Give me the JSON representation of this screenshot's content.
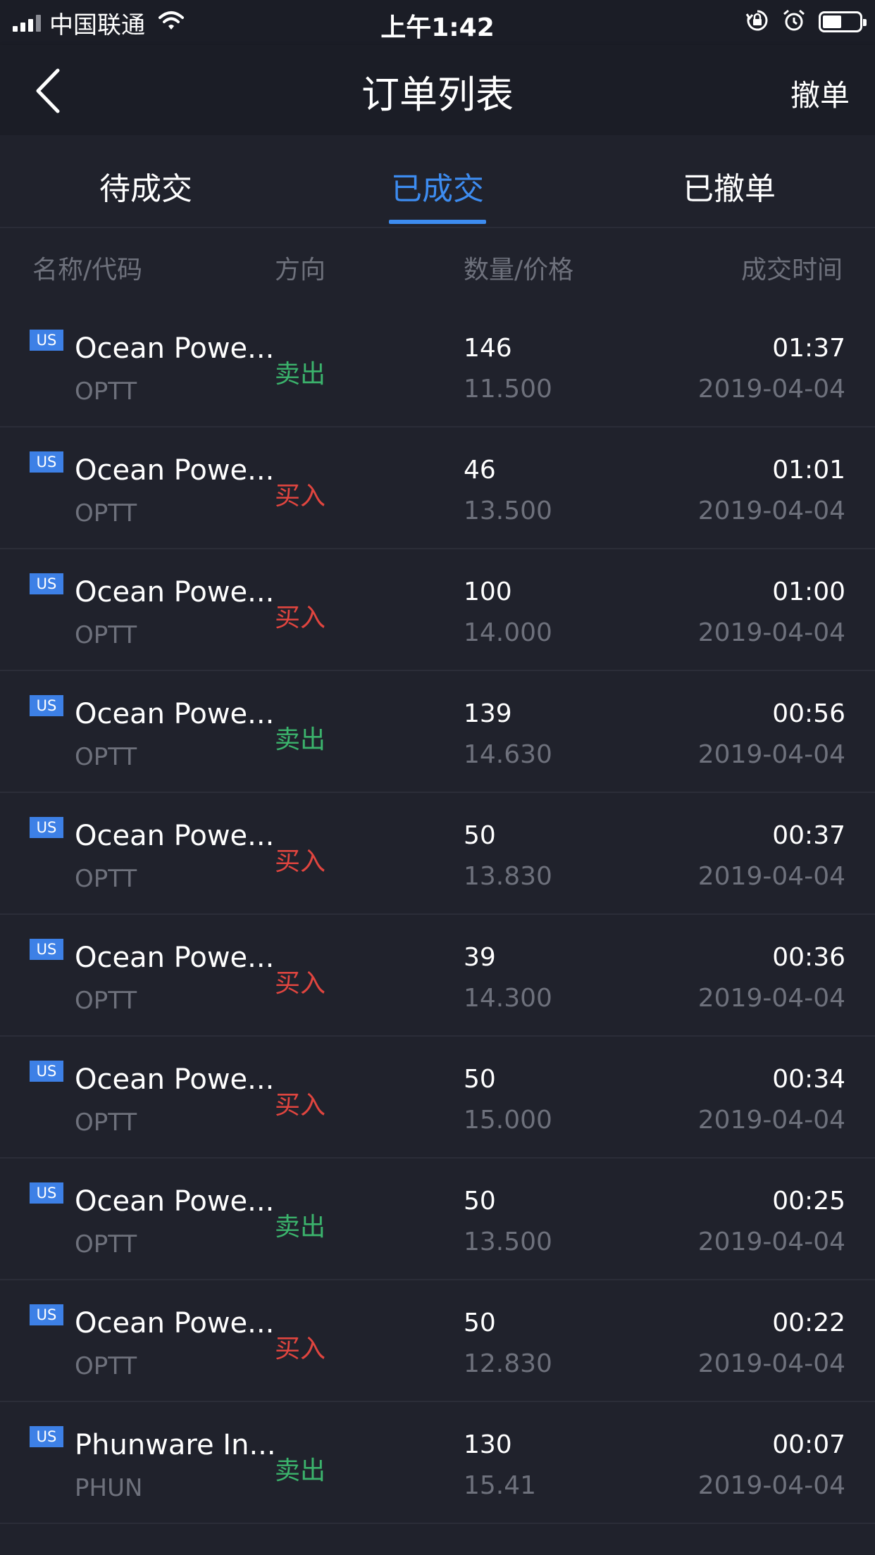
{
  "status_bar": {
    "carrier": "中国联通",
    "time": "上午1:42",
    "icons": [
      "signal-icon",
      "wifi-icon",
      "rotation-lock-icon",
      "alarm-icon",
      "battery-icon"
    ]
  },
  "nav": {
    "title": "订单列表",
    "action": "撤单",
    "back_icon": "chevron-left-icon"
  },
  "tabs": [
    {
      "label": "待成交",
      "active": false
    },
    {
      "label": "已成交",
      "active": true
    },
    {
      "label": "已撤单",
      "active": false
    }
  ],
  "table": {
    "headers": {
      "name_code": "名称/代码",
      "direction": "方向",
      "qty_price": "数量/价格",
      "trade_time": "成交时间"
    },
    "rows": [
      {
        "market": "US",
        "name": "Ocean Powe...",
        "code": "OPTT",
        "direction": "卖出",
        "side": "sell",
        "qty": "146",
        "price": "11.500",
        "time": "01:37",
        "date": "2019-04-04"
      },
      {
        "market": "US",
        "name": "Ocean Powe...",
        "code": "OPTT",
        "direction": "买入",
        "side": "buy",
        "qty": "46",
        "price": "13.500",
        "time": "01:01",
        "date": "2019-04-04"
      },
      {
        "market": "US",
        "name": "Ocean Powe...",
        "code": "OPTT",
        "direction": "买入",
        "side": "buy",
        "qty": "100",
        "price": "14.000",
        "time": "01:00",
        "date": "2019-04-04"
      },
      {
        "market": "US",
        "name": "Ocean Powe...",
        "code": "OPTT",
        "direction": "卖出",
        "side": "sell",
        "qty": "139",
        "price": "14.630",
        "time": "00:56",
        "date": "2019-04-04"
      },
      {
        "market": "US",
        "name": "Ocean Powe...",
        "code": "OPTT",
        "direction": "买入",
        "side": "buy",
        "qty": "50",
        "price": "13.830",
        "time": "00:37",
        "date": "2019-04-04"
      },
      {
        "market": "US",
        "name": "Ocean Powe...",
        "code": "OPTT",
        "direction": "买入",
        "side": "buy",
        "qty": "39",
        "price": "14.300",
        "time": "00:36",
        "date": "2019-04-04"
      },
      {
        "market": "US",
        "name": "Ocean Powe...",
        "code": "OPTT",
        "direction": "买入",
        "side": "buy",
        "qty": "50",
        "price": "15.000",
        "time": "00:34",
        "date": "2019-04-04"
      },
      {
        "market": "US",
        "name": "Ocean Powe...",
        "code": "OPTT",
        "direction": "卖出",
        "side": "sell",
        "qty": "50",
        "price": "13.500",
        "time": "00:25",
        "date": "2019-04-04"
      },
      {
        "market": "US",
        "name": "Ocean Powe...",
        "code": "OPTT",
        "direction": "买入",
        "side": "buy",
        "qty": "50",
        "price": "12.830",
        "time": "00:22",
        "date": "2019-04-04"
      },
      {
        "market": "US",
        "name": "Phunware In...",
        "code": "PHUN",
        "direction": "卖出",
        "side": "sell",
        "qty": "130",
        "price": "15.41",
        "time": "00:07",
        "date": "2019-04-04"
      }
    ]
  },
  "colors": {
    "background": "#20222c",
    "bar_background": "#1b1d26",
    "accent": "#3d8cf0",
    "sell": "#3bb36c",
    "buy": "#e0453f",
    "muted_text": "#6e717c"
  }
}
